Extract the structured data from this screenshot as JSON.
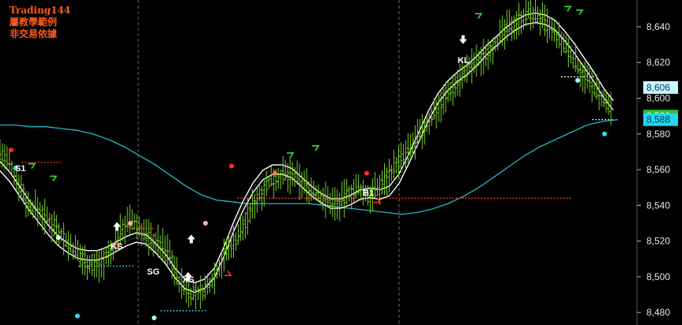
{
  "watermark": {
    "line1": "Trading144",
    "line2": "屬教學範例",
    "line3": "非交易依據"
  },
  "colors": {
    "background": "#000000",
    "price_bars": "#7ccf2a",
    "channel": "#ffffff",
    "slow_ma": "#26b8c8",
    "signal_line_red": "#ff3b2b",
    "signal_line_cyan": "#3fd6e6",
    "label_cyan_bg": "#c9f6ff",
    "label_green_bg": "#2fbf2f",
    "label_teal_bg": "#22d6ee"
  },
  "chart_data": {
    "type": "line",
    "title": "",
    "xlabel": "",
    "ylabel": "",
    "ylim": [
      8473,
      8655
    ],
    "y_ticks": [
      "8,480",
      "8,500",
      "8,520",
      "8,540",
      "8,560",
      "8,580",
      "8,600",
      "8,620",
      "8,640"
    ],
    "session_dividers": 3,
    "price_series": [
      8570,
      8563,
      8553,
      8540,
      8538,
      8532,
      8528,
      8520,
      8514,
      8509,
      8506,
      8509,
      8515,
      8528,
      8531,
      8526,
      8521,
      8518,
      8513,
      8497,
      8491,
      8490,
      8494,
      8503,
      8514,
      8521,
      8530,
      8542,
      8550,
      8555,
      8557,
      8556,
      8553,
      8549,
      8545,
      8542,
      8541,
      8547,
      8549,
      8545,
      8549,
      8556,
      8563,
      8568,
      8576,
      8582,
      8592,
      8599,
      8606,
      8613,
      8618,
      8622,
      8628,
      8634,
      8640,
      8644,
      8648,
      8646,
      8640,
      8634,
      8628,
      8620,
      8612,
      8605,
      8598,
      8591
    ],
    "channel_center": [
      8562,
      8556,
      8548,
      8540,
      8533,
      8526,
      8520,
      8516,
      8513,
      8512,
      8512,
      8514,
      8517,
      8520,
      8522,
      8521,
      8516,
      8510,
      8502,
      8496,
      8494,
      8496,
      8502,
      8514,
      8528,
      8540,
      8550,
      8557,
      8560,
      8560,
      8558,
      8553,
      8548,
      8544,
      8541,
      8541,
      8543,
      8546,
      8547,
      8546,
      8548,
      8555,
      8566,
      8578,
      8590,
      8600,
      8607,
      8612,
      8616,
      8621,
      8627,
      8632,
      8637,
      8641,
      8644,
      8645,
      8644,
      8641,
      8635,
      8628,
      8620,
      8612,
      8603,
      8596
    ],
    "slow_ma": [
      8585,
      8585,
      8584,
      8584,
      8583,
      8582,
      8580,
      8577,
      8573,
      8568,
      8563,
      8557,
      8551,
      8546,
      8543,
      8542,
      8541,
      8541,
      8541,
      8541,
      8541,
      8540,
      8539,
      8538,
      8537,
      8536,
      8535,
      8536,
      8538,
      8541,
      8545,
      8550,
      8556,
      8562,
      8568,
      8573,
      8577,
      8581,
      8585,
      8587,
      8588
    ],
    "signal_lines": [
      {
        "y": 8564,
        "x_range": [
          3,
          11
        ],
        "color": "red"
      },
      {
        "y": 8527,
        "x_range": [
          24,
          29
        ],
        "color": "red"
      },
      {
        "y": 8506,
        "x_range": [
          14,
          25
        ],
        "color": "cyan"
      },
      {
        "y": 8481,
        "x_range": [
          30,
          39
        ],
        "color": "cyan"
      },
      {
        "y": 8544,
        "x_range": [
          45,
          110
        ],
        "color": "red"
      },
      {
        "y": 8612,
        "x_range": [
          108,
          115
        ],
        "color": "white"
      },
      {
        "y": 8588,
        "x_range": [
          114,
          118
        ],
        "color": "white"
      }
    ],
    "labels": [
      {
        "text": "S1",
        "x": 8,
        "y": 8563
      },
      {
        "text": "KS",
        "x": 31,
        "y": 8517
      },
      {
        "text": "SG",
        "x": 41,
        "y": 8497
      },
      {
        "text": "XS",
        "x": 51,
        "y": 8493
      },
      {
        "text": "KL",
        "x": 125,
        "y": 8628
      },
      {
        "text": "B1",
        "x": 100,
        "y": 8545
      }
    ],
    "last_price_labels": [
      "8,606",
      "8,590",
      "8,588"
    ]
  }
}
